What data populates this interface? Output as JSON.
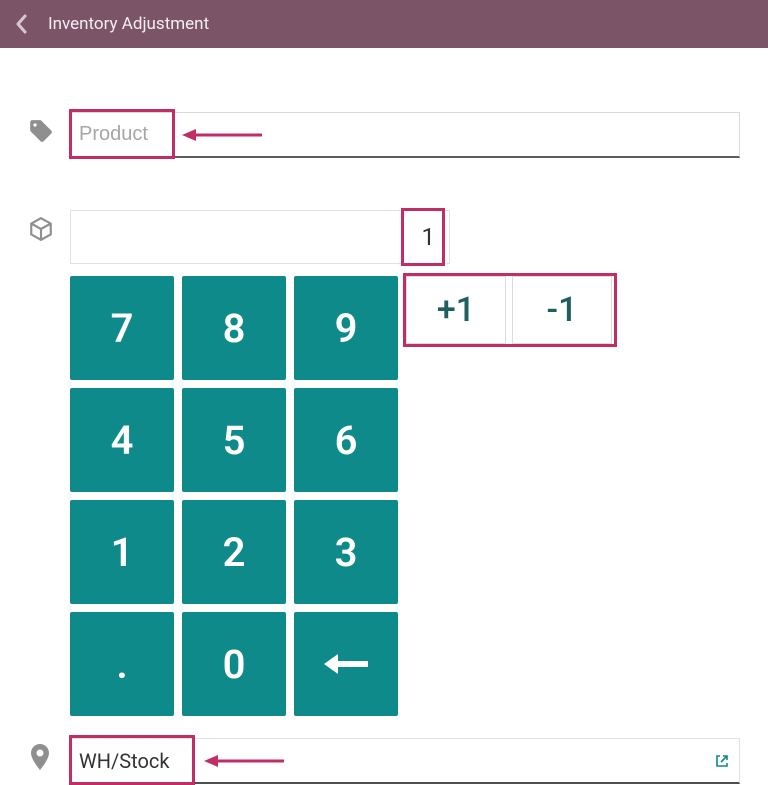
{
  "header": {
    "title": "Inventory Adjustment"
  },
  "product": {
    "placeholder": "Product",
    "value": ""
  },
  "quantity": {
    "value": "1"
  },
  "keypad": {
    "keys": [
      "7",
      "8",
      "9",
      "4",
      "5",
      "6",
      "1",
      "2",
      "3",
      ".",
      "0"
    ],
    "plus": "+1",
    "minus": "-1"
  },
  "location": {
    "value": "WH/Stock"
  }
}
